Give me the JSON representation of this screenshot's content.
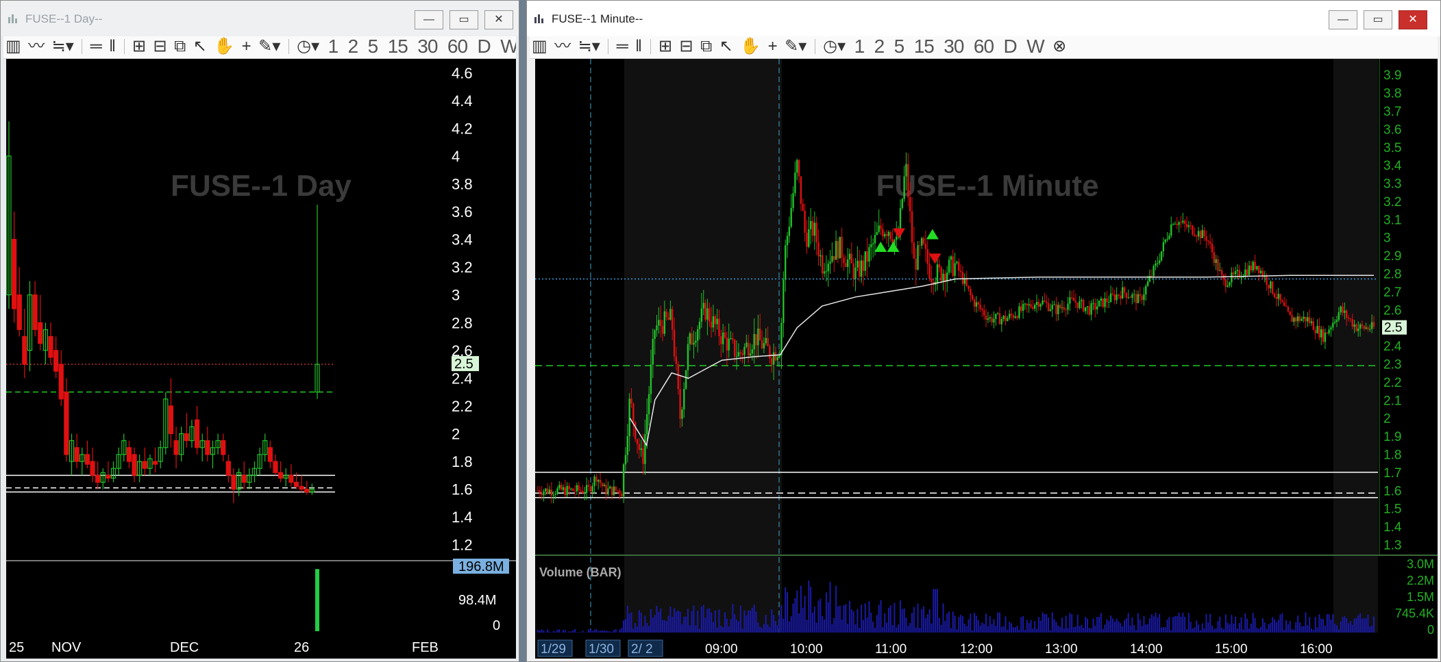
{
  "windows": {
    "day": {
      "title": "FUSE--1 Day--",
      "watermark": "FUSE--1 Day",
      "price_ticks": [
        "4.6",
        "4.4",
        "4.2",
        "4",
        "3.8",
        "3.6",
        "3.4",
        "3.2",
        "3",
        "2.8",
        "2.6",
        "2.4",
        "2.2",
        "2",
        "1.8",
        "1.6",
        "1.4",
        "1.2"
      ],
      "last_price": "2.5",
      "volume_ticks": [
        "196.8M",
        "98.4M",
        "0"
      ],
      "date_labels": [
        "25",
        "NOV",
        "DEC",
        "26",
        "FEB"
      ]
    },
    "minute": {
      "title": "FUSE--1 Minute--",
      "watermark": "FUSE--1 Minute",
      "price_ticks": [
        "3.9",
        "3.8",
        "3.7",
        "3.6",
        "3.5",
        "3.4",
        "3.3",
        "3.2",
        "3.1",
        "3",
        "2.9",
        "2.8",
        "2.7",
        "2.6",
        "2.5",
        "2.4",
        "2.3",
        "2.2",
        "2.1",
        "2",
        "1.9",
        "1.8",
        "1.7",
        "1.6",
        "1.5",
        "1.4",
        "1.3"
      ],
      "last_price": "2.5",
      "volume_label": "Volume (BAR)",
      "volume_ticks": [
        "3.0M",
        "2.2M",
        "1.5M",
        "745.4K",
        "0"
      ],
      "time_labels": [
        "1/29",
        "1/30",
        "2/ 2",
        "09:00",
        "10:00",
        "11:00",
        "12:00",
        "13:00",
        "14:00",
        "15:00",
        "16:00"
      ]
    }
  },
  "toolbar": {
    "intervals": [
      "1",
      "2",
      "5",
      "15",
      "30",
      "60",
      "D",
      "W"
    ]
  },
  "window_buttons": {
    "minimize": "—",
    "maximize": "▭",
    "close": "✕"
  },
  "colors": {
    "up": "#22c22a",
    "down": "#e01010",
    "volume_day": "#22cc44",
    "volume_min": "#1a1aa8",
    "axis_text": "#ffffff",
    "axis_text_min": "#22b022",
    "reference_green": "#22cc22",
    "reference_red": "#c03030",
    "reference_blue": "#3aa0e0"
  },
  "chart_data": [
    {
      "type": "candlestick",
      "name": "FUSE--1 Day",
      "ylim": [
        1.1,
        4.7
      ],
      "reference_lines": [
        {
          "value": 2.5,
          "style": "dotted",
          "color": "red"
        },
        {
          "value": 2.3,
          "style": "dashed",
          "color": "green"
        },
        {
          "value": 1.7,
          "style": "solid",
          "color": "white"
        },
        {
          "value": 1.61,
          "style": "dashed",
          "color": "white"
        },
        {
          "value": 1.58,
          "style": "solid",
          "color": "white"
        }
      ],
      "candles": [
        {
          "o": 3.0,
          "h": 4.25,
          "l": 2.9,
          "c": 4.0
        },
        {
          "o": 3.4,
          "h": 3.6,
          "l": 2.8,
          "c": 2.9
        },
        {
          "o": 3.0,
          "h": 3.2,
          "l": 2.7,
          "c": 2.75
        },
        {
          "o": 2.7,
          "h": 2.9,
          "l": 2.4,
          "c": 2.5
        },
        {
          "o": 2.6,
          "h": 3.1,
          "l": 2.45,
          "c": 3.0
        },
        {
          "o": 3.0,
          "h": 3.1,
          "l": 2.7,
          "c": 2.75
        },
        {
          "o": 2.8,
          "h": 3.0,
          "l": 2.6,
          "c": 2.65
        },
        {
          "o": 2.6,
          "h": 2.8,
          "l": 2.5,
          "c": 2.75
        },
        {
          "o": 2.7,
          "h": 2.8,
          "l": 2.5,
          "c": 2.55
        },
        {
          "o": 2.6,
          "h": 2.7,
          "l": 2.4,
          "c": 2.45
        },
        {
          "o": 2.5,
          "h": 2.6,
          "l": 2.2,
          "c": 2.25
        },
        {
          "o": 2.3,
          "h": 2.4,
          "l": 1.8,
          "c": 1.85
        },
        {
          "o": 1.8,
          "h": 2.0,
          "l": 1.7,
          "c": 1.95
        },
        {
          "o": 1.9,
          "h": 2.0,
          "l": 1.75,
          "c": 1.8
        },
        {
          "o": 1.8,
          "h": 1.9,
          "l": 1.7,
          "c": 1.85
        },
        {
          "o": 1.85,
          "h": 1.95,
          "l": 1.75,
          "c": 1.78
        },
        {
          "o": 1.8,
          "h": 1.9,
          "l": 1.65,
          "c": 1.7
        },
        {
          "o": 1.7,
          "h": 1.8,
          "l": 1.6,
          "c": 1.65
        },
        {
          "o": 1.65,
          "h": 1.75,
          "l": 1.6,
          "c": 1.72
        },
        {
          "o": 1.7,
          "h": 1.8,
          "l": 1.65,
          "c": 1.68
        },
        {
          "o": 1.68,
          "h": 1.8,
          "l": 1.65,
          "c": 1.75
        },
        {
          "o": 1.75,
          "h": 1.9,
          "l": 1.7,
          "c": 1.85
        },
        {
          "o": 1.85,
          "h": 2.0,
          "l": 1.8,
          "c": 1.95
        },
        {
          "o": 1.9,
          "h": 1.95,
          "l": 1.75,
          "c": 1.8
        },
        {
          "o": 1.85,
          "h": 1.9,
          "l": 1.65,
          "c": 1.7
        },
        {
          "o": 1.7,
          "h": 1.85,
          "l": 1.65,
          "c": 1.8
        },
        {
          "o": 1.8,
          "h": 1.9,
          "l": 1.7,
          "c": 1.75
        },
        {
          "o": 1.75,
          "h": 1.85,
          "l": 1.7,
          "c": 1.82
        },
        {
          "o": 1.8,
          "h": 1.9,
          "l": 1.72,
          "c": 1.78
        },
        {
          "o": 1.8,
          "h": 1.95,
          "l": 1.75,
          "c": 1.9
        },
        {
          "o": 1.9,
          "h": 2.3,
          "l": 1.85,
          "c": 2.25
        },
        {
          "o": 2.2,
          "h": 2.4,
          "l": 1.9,
          "c": 2.0
        },
        {
          "o": 1.95,
          "h": 2.05,
          "l": 1.75,
          "c": 1.85
        },
        {
          "o": 1.85,
          "h": 2.05,
          "l": 1.8,
          "c": 2.0
        },
        {
          "o": 2.0,
          "h": 2.15,
          "l": 1.9,
          "c": 1.95
        },
        {
          "o": 1.95,
          "h": 2.1,
          "l": 1.9,
          "c": 2.05
        },
        {
          "o": 2.1,
          "h": 2.2,
          "l": 1.85,
          "c": 1.9
        },
        {
          "o": 1.9,
          "h": 2.0,
          "l": 1.8,
          "c": 1.95
        },
        {
          "o": 1.95,
          "h": 2.05,
          "l": 1.8,
          "c": 1.85
        },
        {
          "o": 1.85,
          "h": 1.95,
          "l": 1.75,
          "c": 1.9
        },
        {
          "o": 1.9,
          "h": 2.0,
          "l": 1.85,
          "c": 1.95
        },
        {
          "o": 1.95,
          "h": 2.0,
          "l": 1.8,
          "c": 1.85
        },
        {
          "o": 1.8,
          "h": 1.85,
          "l": 1.65,
          "c": 1.7
        },
        {
          "o": 1.7,
          "h": 1.75,
          "l": 1.5,
          "c": 1.6
        },
        {
          "o": 1.6,
          "h": 1.75,
          "l": 1.55,
          "c": 1.72
        },
        {
          "o": 1.7,
          "h": 1.8,
          "l": 1.6,
          "c": 1.65
        },
        {
          "o": 1.65,
          "h": 1.75,
          "l": 1.6,
          "c": 1.7
        },
        {
          "o": 1.7,
          "h": 1.8,
          "l": 1.65,
          "c": 1.75
        },
        {
          "o": 1.75,
          "h": 1.9,
          "l": 1.7,
          "c": 1.85
        },
        {
          "o": 1.85,
          "h": 2.0,
          "l": 1.8,
          "c": 1.95
        },
        {
          "o": 1.9,
          "h": 1.95,
          "l": 1.75,
          "c": 1.8
        },
        {
          "o": 1.8,
          "h": 1.85,
          "l": 1.7,
          "c": 1.72
        },
        {
          "o": 1.72,
          "h": 1.8,
          "l": 1.65,
          "c": 1.68
        },
        {
          "o": 1.68,
          "h": 1.75,
          "l": 1.62,
          "c": 1.7
        },
        {
          "o": 1.7,
          "h": 1.78,
          "l": 1.62,
          "c": 1.65
        },
        {
          "o": 1.65,
          "h": 1.72,
          "l": 1.6,
          "c": 1.62
        },
        {
          "o": 1.62,
          "h": 1.7,
          "l": 1.58,
          "c": 1.6
        },
        {
          "o": 1.6,
          "h": 1.66,
          "l": 1.56,
          "c": 1.58
        },
        {
          "o": 1.58,
          "h": 1.64,
          "l": 1.56,
          "c": 1.6
        },
        {
          "o": 2.3,
          "h": 3.65,
          "l": 2.25,
          "c": 2.5
        }
      ],
      "volume_ylim": [
        0,
        196.8
      ],
      "volume_unit": "M",
      "volume_spike": {
        "index": 59,
        "value": 190
      }
    },
    {
      "type": "candlestick",
      "name": "FUSE--1 Minute",
      "ylim": [
        1.26,
        3.95
      ],
      "reference_lines": [
        {
          "value": 2.77,
          "style": "dotted",
          "color": "blue"
        },
        {
          "value": 2.29,
          "style": "dashed",
          "color": "green"
        },
        {
          "value": 1.7,
          "style": "solid",
          "color": "white"
        },
        {
          "value": 1.585,
          "style": "dashed",
          "color": "white"
        },
        {
          "value": 1.56,
          "style": "solid",
          "color": "white"
        }
      ],
      "path": [
        [
          0.0,
          1.6
        ],
        [
          0.06,
          1.6
        ],
        [
          0.07,
          1.68
        ],
        [
          0.08,
          1.6
        ],
        [
          0.1,
          1.6
        ],
        [
          0.11,
          2.1
        ],
        [
          0.118,
          1.9
        ],
        [
          0.125,
          1.75
        ],
        [
          0.13,
          2.0
        ],
        [
          0.14,
          2.5
        ],
        [
          0.16,
          2.55
        ],
        [
          0.17,
          2.0
        ],
        [
          0.18,
          2.4
        ],
        [
          0.2,
          2.6
        ],
        [
          0.22,
          2.45
        ],
        [
          0.24,
          2.35
        ],
        [
          0.26,
          2.45
        ],
        [
          0.28,
          2.35
        ],
        [
          0.29,
          2.4
        ],
        [
          0.295,
          2.9
        ],
        [
          0.31,
          3.4
        ],
        [
          0.32,
          3.0
        ],
        [
          0.33,
          3.05
        ],
        [
          0.34,
          2.85
        ],
        [
          0.36,
          2.95
        ],
        [
          0.38,
          2.8
        ],
        [
          0.39,
          2.85
        ],
        [
          0.4,
          2.95
        ],
        [
          0.41,
          3.05
        ],
        [
          0.42,
          3.05
        ],
        [
          0.43,
          2.95
        ],
        [
          0.44,
          3.4
        ],
        [
          0.45,
          2.85
        ],
        [
          0.46,
          2.95
        ],
        [
          0.47,
          2.8
        ],
        [
          0.48,
          2.8
        ],
        [
          0.5,
          2.85
        ],
        [
          0.52,
          2.65
        ],
        [
          0.54,
          2.55
        ],
        [
          0.56,
          2.55
        ],
        [
          0.58,
          2.6
        ],
        [
          0.6,
          2.65
        ],
        [
          0.62,
          2.6
        ],
        [
          0.64,
          2.65
        ],
        [
          0.66,
          2.6
        ],
        [
          0.68,
          2.65
        ],
        [
          0.7,
          2.7
        ],
        [
          0.72,
          2.65
        ],
        [
          0.74,
          2.85
        ],
        [
          0.76,
          3.1
        ],
        [
          0.78,
          3.05
        ],
        [
          0.8,
          3.0
        ],
        [
          0.82,
          2.75
        ],
        [
          0.84,
          2.8
        ],
        [
          0.86,
          2.85
        ],
        [
          0.88,
          2.7
        ],
        [
          0.9,
          2.55
        ],
        [
          0.92,
          2.55
        ],
        [
          0.94,
          2.45
        ],
        [
          0.96,
          2.6
        ],
        [
          0.98,
          2.5
        ],
        [
          1.0,
          2.5
        ]
      ],
      "vwap": [
        [
          0.11,
          2.0
        ],
        [
          0.13,
          1.85
        ],
        [
          0.14,
          2.1
        ],
        [
          0.16,
          2.25
        ],
        [
          0.18,
          2.22
        ],
        [
          0.2,
          2.27
        ],
        [
          0.22,
          2.32
        ],
        [
          0.26,
          2.34
        ],
        [
          0.29,
          2.35
        ],
        [
          0.31,
          2.5
        ],
        [
          0.34,
          2.62
        ],
        [
          0.38,
          2.67
        ],
        [
          0.42,
          2.7
        ],
        [
          0.46,
          2.73
        ],
        [
          0.5,
          2.77
        ],
        [
          0.6,
          2.78
        ],
        [
          0.7,
          2.78
        ],
        [
          0.8,
          2.78
        ],
        [
          0.9,
          2.79
        ],
        [
          1.0,
          2.79
        ]
      ],
      "signals": [
        {
          "x": 0.41,
          "y": 2.95,
          "dir": "up"
        },
        {
          "x": 0.425,
          "y": 2.95,
          "dir": "up"
        },
        {
          "x": 0.432,
          "y": 3.02,
          "dir": "down"
        },
        {
          "x": 0.472,
          "y": 3.02,
          "dir": "up"
        },
        {
          "x": 0.475,
          "y": 2.88,
          "dir": "down"
        }
      ],
      "volume_ylim": [
        0,
        3.0
      ],
      "volume_unit": "M"
    }
  ]
}
